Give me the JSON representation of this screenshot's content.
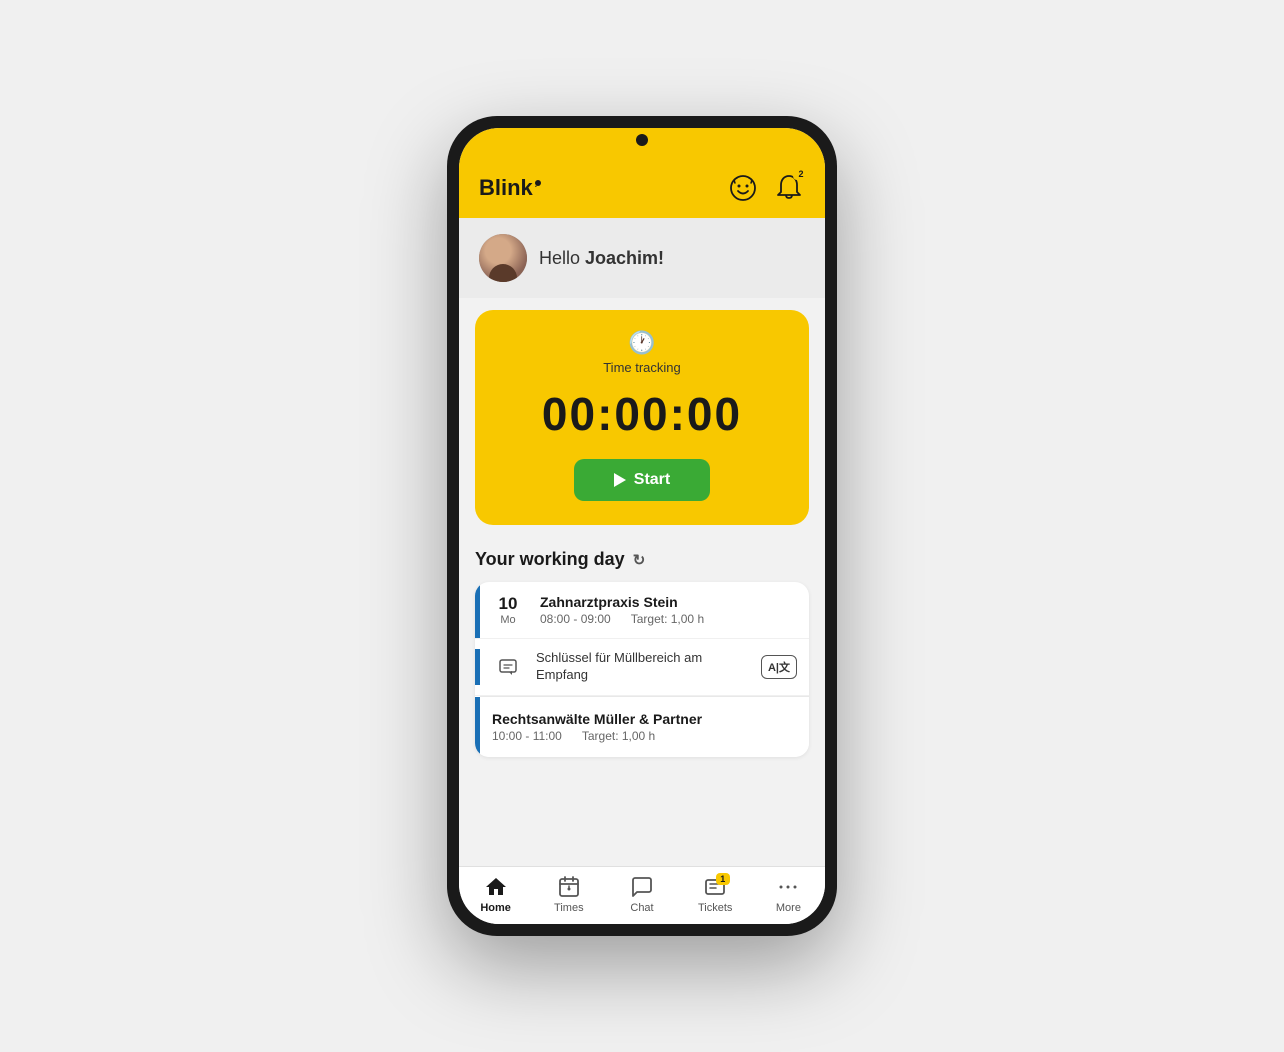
{
  "app": {
    "logo": "Blink",
    "header": {
      "avatar_icon": "smiley-icon",
      "bell_icon": "bell-icon",
      "notification_count": "2"
    }
  },
  "greeting": {
    "text_prefix": "Hello ",
    "user_name": "Joachim!",
    "full_text": "Hello Joachim!"
  },
  "time_tracking": {
    "label": "Time tracking",
    "time_display": "00:00:00",
    "start_button": "Start"
  },
  "working_day": {
    "title": "Your working day",
    "items": [
      {
        "date_num": "10",
        "date_day": "Mo",
        "title": "Zahnarztpraxis Stein",
        "time": "08:00 - 09:00",
        "target": "Target: 1,00 h",
        "message": "Schlüssel für Müllbereich am Empfang",
        "has_translate": true
      },
      {
        "title": "Rechtsanwälte Müller & Partner",
        "time": "10:00 - 11:00",
        "target": "Target: 1,00 h"
      }
    ]
  },
  "bottom_nav": {
    "items": [
      {
        "id": "home",
        "label": "Home",
        "active": true
      },
      {
        "id": "times",
        "label": "Times",
        "active": false
      },
      {
        "id": "chat",
        "label": "Chat",
        "active": false
      },
      {
        "id": "tickets",
        "label": "Tickets",
        "active": false,
        "badge": "1"
      },
      {
        "id": "more",
        "label": "More",
        "active": false
      }
    ]
  }
}
